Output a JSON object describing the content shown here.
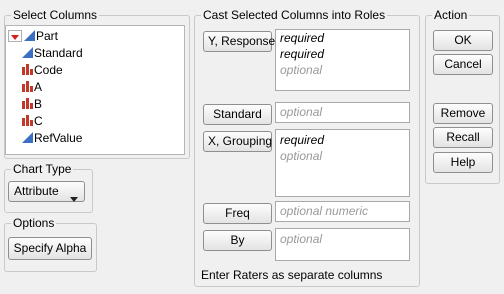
{
  "select_columns": {
    "title": "Select Columns",
    "columns": [
      {
        "name": "Part",
        "type": "continuous"
      },
      {
        "name": "Standard",
        "type": "continuous"
      },
      {
        "name": "Code",
        "type": "nominal"
      },
      {
        "name": "A",
        "type": "nominal"
      },
      {
        "name": "B",
        "type": "nominal"
      },
      {
        "name": "C",
        "type": "nominal"
      },
      {
        "name": "RefValue",
        "type": "continuous"
      }
    ]
  },
  "chart_type": {
    "title": "Chart Type",
    "selected": "Attribute"
  },
  "options": {
    "title": "Options",
    "specify_alpha_label": "Specify Alpha"
  },
  "cast_roles": {
    "title": "Cast Selected Columns into Roles",
    "roles": [
      {
        "button": "Y, Response",
        "entries": [
          {
            "text": "required",
            "kind": "required"
          },
          {
            "text": "required",
            "kind": "required"
          },
          {
            "text": "optional",
            "kind": "optional"
          }
        ]
      },
      {
        "button": "Standard",
        "entries": [
          {
            "text": "optional",
            "kind": "optional"
          }
        ]
      },
      {
        "button": "X, Grouping",
        "entries": [
          {
            "text": "required",
            "kind": "required"
          },
          {
            "text": "optional",
            "kind": "optional"
          }
        ]
      },
      {
        "button": "Freq",
        "entries": [
          {
            "text": "optional numeric",
            "kind": "optional"
          }
        ]
      },
      {
        "button": "By",
        "entries": [
          {
            "text": "optional",
            "kind": "optional"
          }
        ]
      }
    ],
    "footer": "Enter Raters as separate columns"
  },
  "action": {
    "title": "Action",
    "ok": "OK",
    "cancel": "Cancel",
    "remove": "Remove",
    "recall": "Recall",
    "help": "Help"
  },
  "colors": {
    "continuous_icon": "#3a6fc4",
    "nominal_icon": "#c0392b",
    "dropdown_arrow": "#d62020"
  }
}
